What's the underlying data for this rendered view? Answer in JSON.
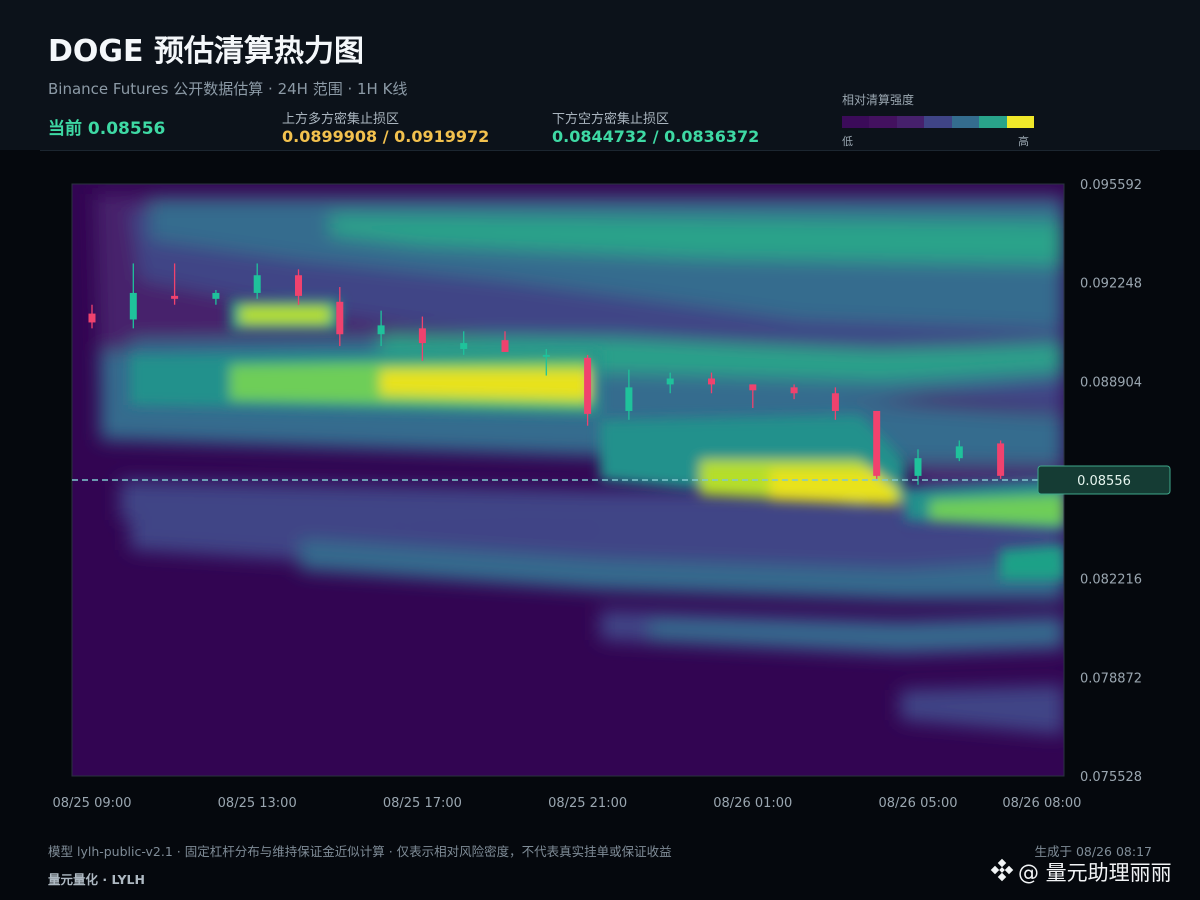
{
  "header": {
    "title": "DOGE 预估清算热力图",
    "subtitle": "Binance Futures 公开数据估算 · 24H 范围 · 1H K线",
    "current_label": "当前 0.08556",
    "upper_zone_label": "上方多方密集止损区",
    "upper_zone_value": "0.0899908 / 0.0919972",
    "lower_zone_label": "下方空方密集止损区",
    "lower_zone_value": "0.0844732 / 0.0836372",
    "legend_title": "相对清算强度",
    "legend_low": "低",
    "legend_high": "高",
    "legend_colors": [
      "#3b0b59",
      "#43115f",
      "#46206c",
      "#3f4486",
      "#346c8e",
      "#29a38a",
      "#f0e82a"
    ]
  },
  "colors": {
    "up_candle": "#1fc29b",
    "down_candle": "#f0426e",
    "current_line": "#7ec9cf",
    "upper_zone": "#f2c14e",
    "lower_zone": "#3ed9a4"
  },
  "chart_data": {
    "type": "heatmap",
    "overlay": "candlestick",
    "y_ticks": [
      "0.095592",
      "0.092248",
      "0.088904",
      "0.085560",
      "0.082216",
      "0.078872",
      "0.075528"
    ],
    "ylim": [
      0.075528,
      0.095592
    ],
    "x_ticks": [
      "08/25 09:00",
      "08/25 13:00",
      "08/25 17:00",
      "08/25 21:00",
      "08/26 01:00",
      "08/26 05:00",
      "08/26 08:00"
    ],
    "current_price": 0.08556,
    "current_price_label": "0.08556",
    "candles": [
      {
        "t": "08/25 09:00",
        "o": 0.0912,
        "h": 0.0915,
        "l": 0.0907,
        "c": 0.0909
      },
      {
        "t": "08/25 10:00",
        "o": 0.091,
        "h": 0.0929,
        "l": 0.0907,
        "c": 0.0919
      },
      {
        "t": "08/25 11:00",
        "o": 0.0918,
        "h": 0.0929,
        "l": 0.0915,
        "c": 0.0917
      },
      {
        "t": "08/25 12:00",
        "o": 0.0917,
        "h": 0.092,
        "l": 0.0915,
        "c": 0.0919
      },
      {
        "t": "08/25 13:00",
        "o": 0.0919,
        "h": 0.0929,
        "l": 0.0917,
        "c": 0.0925
      },
      {
        "t": "08/25 14:00",
        "o": 0.0925,
        "h": 0.0927,
        "l": 0.0915,
        "c": 0.0918
      },
      {
        "t": "08/25 15:00",
        "o": 0.0916,
        "h": 0.0921,
        "l": 0.0901,
        "c": 0.0905
      },
      {
        "t": "08/25 16:00",
        "o": 0.0905,
        "h": 0.0913,
        "l": 0.0901,
        "c": 0.0908
      },
      {
        "t": "08/25 17:00",
        "o": 0.0907,
        "h": 0.0911,
        "l": 0.0896,
        "c": 0.0902
      },
      {
        "t": "08/25 18:00",
        "o": 0.09,
        "h": 0.0906,
        "l": 0.0898,
        "c": 0.0902
      },
      {
        "t": "08/25 19:00",
        "o": 0.0903,
        "h": 0.0906,
        "l": 0.0899,
        "c": 0.0899
      },
      {
        "t": "08/25 20:00",
        "o": 0.0898,
        "h": 0.09,
        "l": 0.0891,
        "c": 0.0898
      },
      {
        "t": "08/25 21:00",
        "o": 0.0897,
        "h": 0.0898,
        "l": 0.0874,
        "c": 0.0878
      },
      {
        "t": "08/25 22:00",
        "o": 0.0879,
        "h": 0.0893,
        "l": 0.0876,
        "c": 0.0887
      },
      {
        "t": "08/25 23:00",
        "o": 0.0888,
        "h": 0.0892,
        "l": 0.0885,
        "c": 0.089
      },
      {
        "t": "08/26 00:00",
        "o": 0.089,
        "h": 0.0892,
        "l": 0.0885,
        "c": 0.0888
      },
      {
        "t": "08/26 01:00",
        "o": 0.0888,
        "h": 0.0888,
        "l": 0.088,
        "c": 0.0886
      },
      {
        "t": "08/26 02:00",
        "o": 0.0887,
        "h": 0.0888,
        "l": 0.0883,
        "c": 0.0885
      },
      {
        "t": "08/26 03:00",
        "o": 0.0885,
        "h": 0.0887,
        "l": 0.0876,
        "c": 0.0879
      },
      {
        "t": "08/26 04:00",
        "o": 0.0879,
        "h": 0.0879,
        "l": 0.0856,
        "c": 0.0857
      },
      {
        "t": "08/26 05:00",
        "o": 0.0857,
        "h": 0.0866,
        "l": 0.0854,
        "c": 0.0863
      },
      {
        "t": "08/26 06:00",
        "o": 0.0863,
        "h": 0.0869,
        "l": 0.0862,
        "c": 0.0867
      },
      {
        "t": "08/26 07:00",
        "o": 0.0868,
        "h": 0.0869,
        "l": 0.0856,
        "c": 0.0857
      }
    ]
  },
  "footer": {
    "note": "模型 lylh-public-v2.1 · 固定杠杆分布与维持保证金近似计算 · 仅表示相对风险密度，不代表真实挂单或保证收益",
    "generated": "生成于 08/26 08:17",
    "brand": "量元量化 · LYLH",
    "watermark": "@ 量元助理丽丽"
  }
}
